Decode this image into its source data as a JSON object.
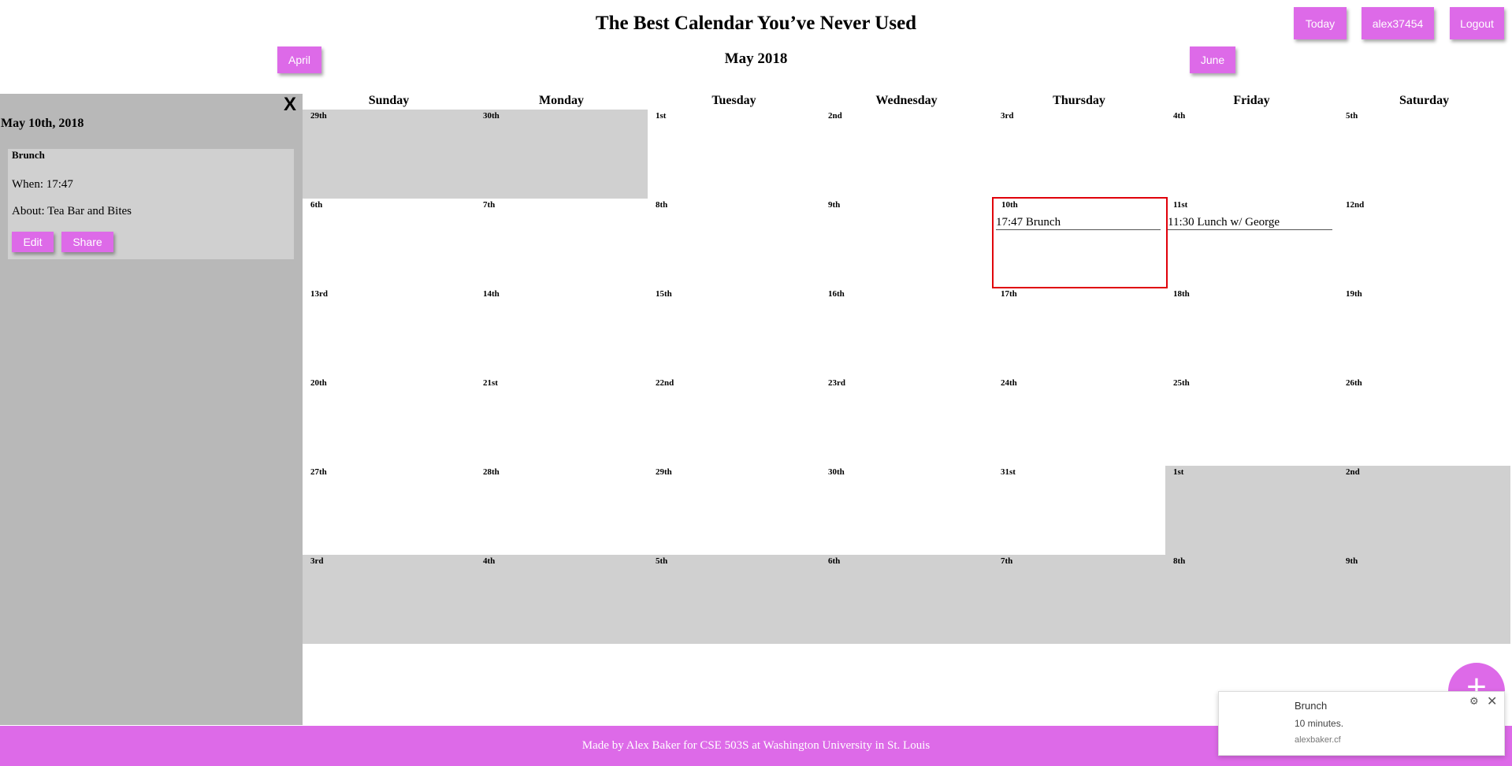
{
  "app_title": "The Best Calendar You’ve Never Used",
  "header": {
    "today_label": "Today",
    "user_label": "alex37454",
    "logout_label": "Logout",
    "prev_month_label": "April",
    "next_month_label": "June",
    "month_title": "May 2018"
  },
  "sidebar": {
    "close_label": "X",
    "date_label": "May 10th, 2018",
    "event": {
      "title": "Brunch",
      "when": "When: 17:47",
      "about": "About: Tea Bar and Bites",
      "edit_label": "Edit",
      "share_label": "Share"
    }
  },
  "calendar": {
    "weekdays": [
      "Sunday",
      "Monday",
      "Tuesday",
      "Wednesday",
      "Thursday",
      "Friday",
      "Saturday"
    ],
    "weeks": [
      [
        {
          "label": "29th",
          "other": true
        },
        {
          "label": "30th",
          "other": true
        },
        {
          "label": "1st"
        },
        {
          "label": "2nd"
        },
        {
          "label": "3rd"
        },
        {
          "label": "4th"
        },
        {
          "label": "5th"
        }
      ],
      [
        {
          "label": "6th"
        },
        {
          "label": "7th"
        },
        {
          "label": "8th"
        },
        {
          "label": "9th"
        },
        {
          "label": "10th",
          "selected": true,
          "events": [
            "17:47 Brunch"
          ]
        },
        {
          "label": "11st",
          "events": [
            "11:30 Lunch w/ George"
          ]
        },
        {
          "label": "12nd"
        }
      ],
      [
        {
          "label": "13rd"
        },
        {
          "label": "14th"
        },
        {
          "label": "15th"
        },
        {
          "label": "16th"
        },
        {
          "label": "17th"
        },
        {
          "label": "18th"
        },
        {
          "label": "19th"
        }
      ],
      [
        {
          "label": "20th"
        },
        {
          "label": "21st"
        },
        {
          "label": "22nd"
        },
        {
          "label": "23rd"
        },
        {
          "label": "24th"
        },
        {
          "label": "25th"
        },
        {
          "label": "26th"
        }
      ],
      [
        {
          "label": "27th"
        },
        {
          "label": "28th"
        },
        {
          "label": "29th"
        },
        {
          "label": "30th"
        },
        {
          "label": "31st"
        },
        {
          "label": "1st",
          "other": true
        },
        {
          "label": "2nd",
          "other": true
        }
      ],
      [
        {
          "label": "3rd",
          "other": true
        },
        {
          "label": "4th",
          "other": true
        },
        {
          "label": "5th",
          "other": true
        },
        {
          "label": "6th",
          "other": true
        },
        {
          "label": "7th",
          "other": true
        },
        {
          "label": "8th",
          "other": true
        },
        {
          "label": "9th",
          "other": true
        }
      ]
    ]
  },
  "fab_label": "+",
  "footer_text": "Made by Alex Baker for CSE 503S at Washington University in St. Louis",
  "notification": {
    "title": "Brunch",
    "body": "10 minutes.",
    "source": "alexbaker.cf",
    "settings_icon": "gear-icon",
    "close_label": "✕"
  },
  "colors": {
    "accent": "#dd6ae8",
    "sidebar_bg": "#b8b8b8",
    "other_month_bg": "#d0d0d0",
    "selected_border": "#e0000a"
  }
}
